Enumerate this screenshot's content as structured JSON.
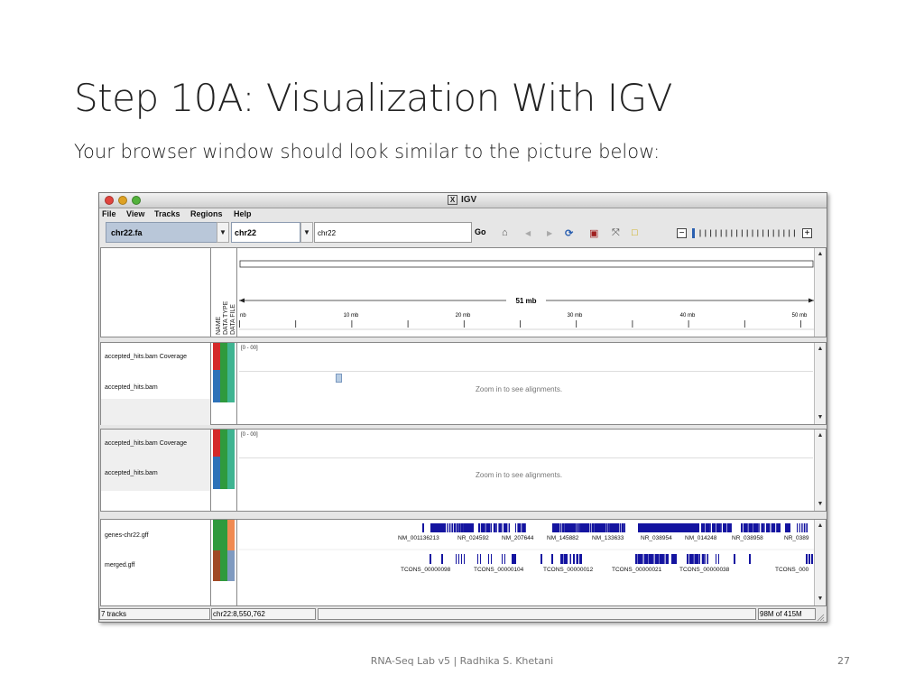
{
  "slide": {
    "title": "Step 10A: Visualization With IGV",
    "subtitle": "Your browser window should look similar to the picture below:",
    "footer": "RNA-Seq Lab v5 | Radhika S. Khetani",
    "page_number": "27"
  },
  "window": {
    "title": "IGV",
    "menu": [
      "File",
      "View",
      "Tracks",
      "Regions",
      "Help"
    ]
  },
  "toolbar": {
    "genome": "chr22.fa",
    "chromosome": "chr22",
    "locus": "chr22",
    "go_label": "Go",
    "icons": [
      "home-icon",
      "back-icon",
      "forward-icon",
      "refresh-icon",
      "region-icon",
      "resize-icon",
      "popup-text-icon"
    ]
  },
  "ruler": {
    "span_label": "51 mb",
    "tick_labels": [
      "nb",
      "10 mb",
      "20 mb",
      "30 mb",
      "40 mb",
      "50 mb"
    ],
    "attr_headers": [
      "NAME",
      "DATA TYPE",
      "DATA FILE"
    ]
  },
  "panels": [
    {
      "tracks": [
        "accepted_hits.bam Coverage",
        "accepted_hits.bam"
      ],
      "range": "[0 - 00]",
      "hint": "Zoom in to see alignments."
    },
    {
      "tracks": [
        "accepted_hits.bam Coverage",
        "accepted_hits.bam"
      ],
      "range": "[0 - 00]",
      "hint": "Zoom in to see alignments."
    }
  ],
  "feature_panel": {
    "tracks": [
      "genes-chr22.gff",
      "merged.gff"
    ],
    "gene_labels": [
      "NM_001136213",
      "NR_024592",
      "NM_207644",
      "NM_145882",
      "NM_133633",
      "NR_038954",
      "NM_014248",
      "NR_038958",
      "NR_0389"
    ],
    "merged_labels": [
      "TCONS_00000098",
      "TCONS_00000104",
      "TCONS_00000012",
      "TCONS_00000021",
      "TCONS_00000038",
      "TCONS_000"
    ]
  },
  "status": {
    "tracks": "7 tracks",
    "position": "chr22:8,550,762",
    "memory": "98M of 415M"
  },
  "colors": {
    "feature_blue": "#1414a0",
    "attr_red": "#d42a2a",
    "attr_blue": "#2e72b8",
    "attr_teal": "#3fb491",
    "attr_green": "#2f9a3d",
    "attr_orange": "#f08a52",
    "attr_brown": "#a04a25",
    "attr_steel": "#7f9ac0",
    "selector_bg": "#b9c7d9"
  }
}
